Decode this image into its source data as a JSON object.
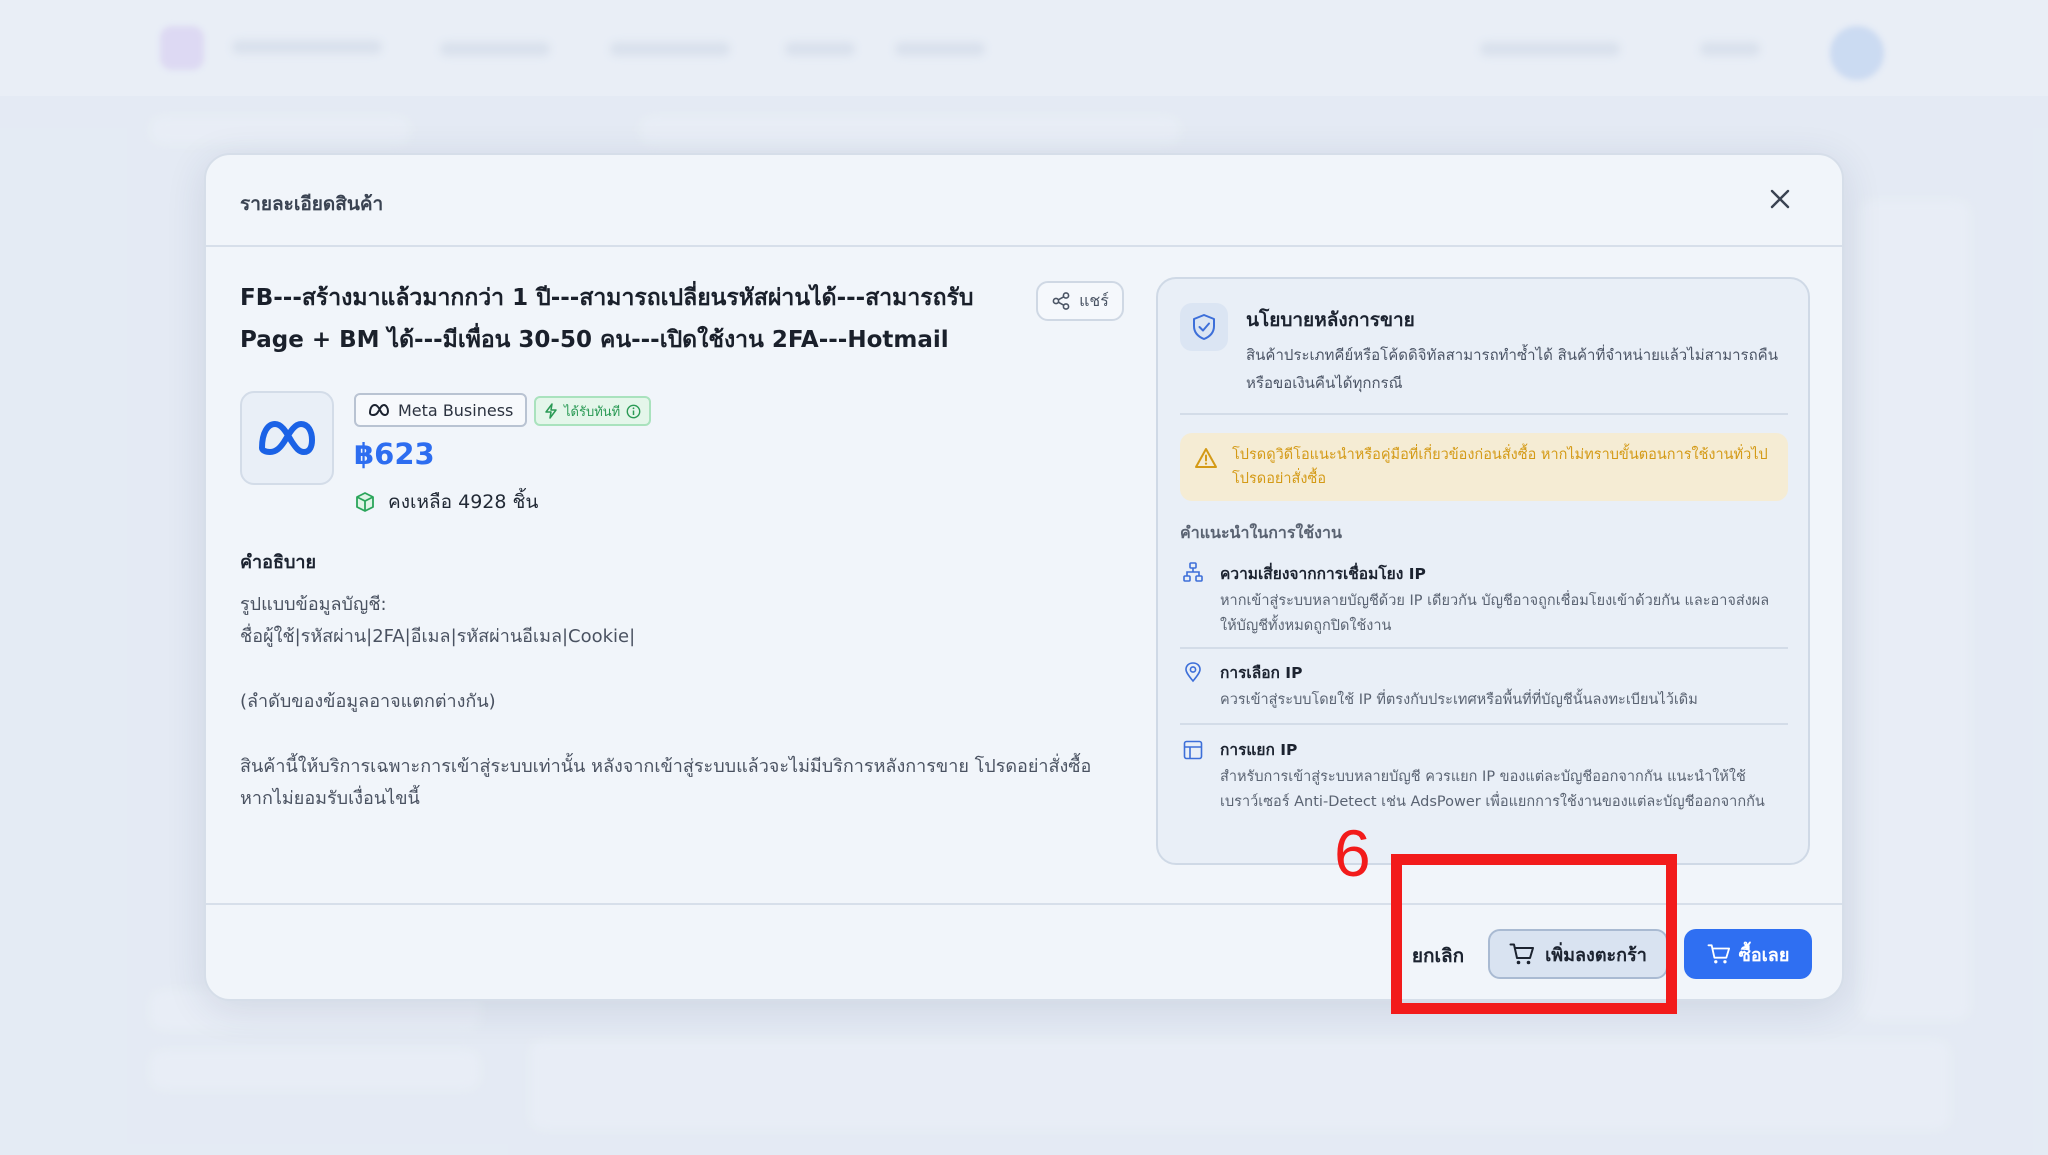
{
  "modal": {
    "title": "รายละเอียดสินค้า",
    "product_title": "FB---สร้างมาแล้วมากกว่า 1 ปี---สามารถเปลี่ยนรหัสผ่านได้---สามารถรับ Page + BM ได้---มีเพื่อน 30-50 คน---เปิดใช้งาน 2FA---Hotmail",
    "share_label": "แชร์",
    "brand_badge": "Meta Business",
    "instant_badge": "ได้รับทันที",
    "price": "฿623",
    "stock": "คงเหลือ 4928 ชิ้น",
    "description": {
      "heading": "คำอธิบาย",
      "line1": "รูปแบบข้อมูลบัญชี:",
      "line2": "ชื่อผู้ใช้|รหัสผ่าน|2FA|อีเมล|รหัสผ่านอีเมล|Cookie|",
      "line3": "(ลำดับของข้อมูลอาจแตกต่างกัน)",
      "line4": "สินค้านี้ให้บริการเฉพาะการเข้าสู่ระบบเท่านั้น หลังจากเข้าสู่ระบบแล้วจะไม่มีบริการหลังการขาย โปรดอย่าสั่งซื้อ",
      "line5": "หากไม่ยอมรับเงื่อนไขนี้"
    }
  },
  "policy": {
    "title": "นโยบายหลังการขาย",
    "text": "สินค้าประเภทคีย์หรือโค้ดดิจิทัลสามารถทำซ้ำได้ สินค้าที่จำหน่ายแล้วไม่สามารถคืนหรือขอเงินคืนได้ทุกกรณี",
    "warning": "โปรดดูวิดีโอแนะนำหรือคู่มือที่เกี่ยวข้องก่อนสั่งซื้อ หากไม่ทราบขั้นตอนการใช้งานทั่วไป โปรดอย่าสั่งซื้อ",
    "tips_heading": "คำแนะนำในการใช้งาน",
    "tips": [
      {
        "title": "ความเสี่ยงจากการเชื่อมโยง IP",
        "text": "หากเข้าสู่ระบบหลายบัญชีด้วย IP เดียวกัน บัญชีอาจถูกเชื่อมโยงเข้าด้วยกัน และอาจส่งผลให้บัญชีทั้งหมดถูกปิดใช้งาน",
        "icon": "network-icon"
      },
      {
        "title": "การเลือก IP",
        "text": "ควรเข้าสู่ระบบโดยใช้ IP ที่ตรงกับประเทศหรือพื้นที่ที่บัญชีนั้นลงทะเบียนไว้เดิม",
        "icon": "location-pin-icon"
      },
      {
        "title": "การแยก IP",
        "text": "สำหรับการเข้าสู่ระบบหลายบัญชี ควรแยก IP ของแต่ละบัญชีออกจากกัน แนะนำให้ใช้เบราว์เซอร์ Anti-Detect เช่น AdsPower เพื่อแยกการใช้งานของแต่ละบัญชีออกจากกัน",
        "icon": "layout-icon"
      }
    ]
  },
  "footer": {
    "cancel_label": "ยกเลิก",
    "cart_label": "เพิ่มลงตะกร้า",
    "buy_label": "ซื้อเลย"
  },
  "annotation": {
    "number": "6"
  },
  "colors": {
    "accent": "#2f6ff2",
    "annotation": "#f21b1b",
    "warning": "#d49a16",
    "success": "#2a9a55"
  }
}
